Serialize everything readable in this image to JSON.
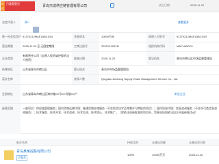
{
  "header": {
    "badge_orange": "存续",
    "badge_red": "已备案登记",
    "company_title": "青岛杰成供应链管理有限公司",
    "right_label": "成立日期",
    "right_value": "2025-11-20"
  },
  "legal_rep": {
    "label": "法定代表人",
    "value": "周**",
    "link_text": "查看更多"
  },
  "rows": [
    {
      "label": "统一社会信用代码",
      "value": "91370212MAF1ABCD1X",
      "mid_label": "注册资本",
      "mid_value": "10000万元",
      "right_label": "纳税人识别号",
      "right_value": "91370212MAF1ABCD1X"
    },
    {
      "label": "营业期限",
      "value": "2025-11-20 至 无固定期限",
      "mid_label": "工商注册号",
      "mid_value": "370212123111",
      "right_label": "组织机构代码",
      "right_value": "MAF1ABCD1"
    },
    {
      "label": "企业类型",
      "value": "有限责任公司（自然人投资或控股的法人独资）",
      "mid_label": "核准日期",
      "mid_value": "2025-11-20",
      "right_label": "登记机关",
      "right_value": "青岛市崂山区市场监督管理局"
    },
    {
      "label": "所属地区",
      "value": "山东省青岛市崂山区",
      "mid_label": "登记机关",
      "mid_value": "青岛市市场监督管理局"
    },
    {
      "label": "英文名称",
      "value": "Qingdao Jiecheng Supply Chain Management Service Co., Ltd.",
      "mid_label": "参保人数",
      "mid_value": "0"
    },
    {
      "label": "注册地址",
      "value": "山东省青岛市崂山区海尔路XX号XX号楼XX户",
      "link_text": "附近企业"
    }
  ],
  "scope": {
    "label": "经营范围",
    "text": "一般项目：供应链管理服务；国内货物运输代理；普通货物仓储服务（不含危险化学品等需许可审批的项目）；国内贸易代理；信息咨询服务（不含许可类信息咨询服务）；技术服务、技术开发、技术咨询、技术交流、技术转让、技术推广。（除依法须经批准的项目外，凭营业执照依法自主开展经营活动）"
  },
  "shareholders": {
    "headers": {
      "name": "股东名称",
      "ratio": "持股比例",
      "amount": "认缴出资额",
      "date": "认缴出资日期"
    },
    "rows": [
      {
        "name": "青岛某某控股有限公司",
        "tag": "大股东",
        "ratio": "100%",
        "amount": "10000万元",
        "date": "2025-11-20"
      }
    ]
  },
  "colors": {
    "accent": "#1f7bd6",
    "badge_red": "#e23b3b",
    "badge_orange": "#f08a24"
  }
}
